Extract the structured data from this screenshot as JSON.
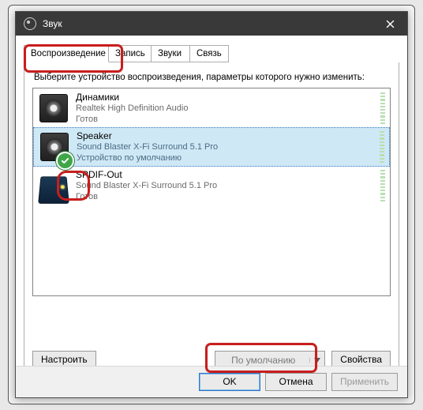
{
  "window": {
    "title": "Звук",
    "close_glyph": "×"
  },
  "tabs": {
    "playback": "Воспроизведение",
    "recording": "Запись",
    "sounds": "Звуки",
    "communications": "Связь"
  },
  "panel": {
    "instruction": "Выберите устройство воспроизведения, параметры которого нужно изменить:"
  },
  "devices": [
    {
      "name": "Динамики",
      "driver": "Realtek High Definition Audio",
      "status": "Готов",
      "icon": "speaker",
      "selected": false,
      "default": false
    },
    {
      "name": "Speaker",
      "driver": "Sound Blaster X-Fi Surround 5.1 Pro",
      "status": "Устройство по умолчанию",
      "icon": "speaker",
      "selected": true,
      "default": true
    },
    {
      "name": "SPDIF-Out",
      "driver": "Sound Blaster X-Fi Surround 5.1 Pro",
      "status": "Готов",
      "icon": "digital-out",
      "selected": false,
      "default": false
    }
  ],
  "buttons": {
    "configure": "Настроить",
    "set_default": "По умолчанию",
    "properties": "Свойства",
    "ok": "OK",
    "cancel": "Отмена",
    "apply": "Применить"
  },
  "colors": {
    "accent": "#cfe8f6",
    "highlight": "#c81e1e"
  }
}
